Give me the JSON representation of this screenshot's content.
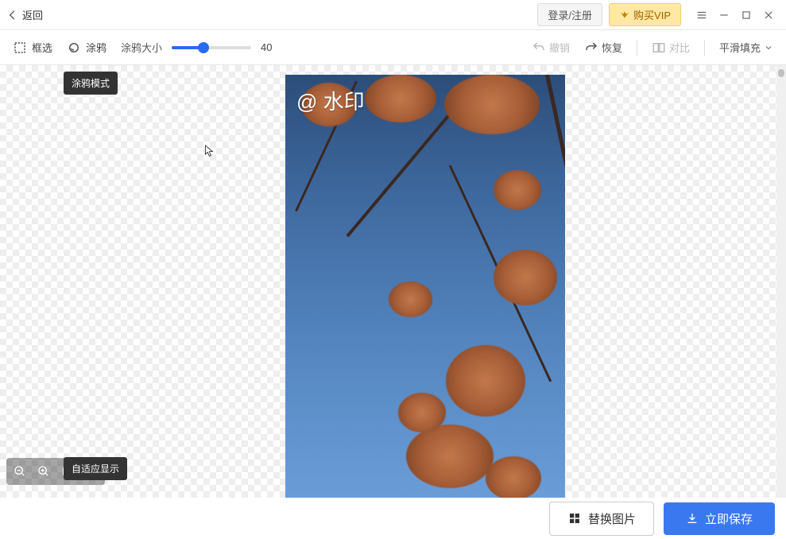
{
  "header": {
    "back": "返回",
    "login": "登录/注册",
    "vip": "购买VIP"
  },
  "toolbar": {
    "marquee": "框选",
    "brush": "涂鸦",
    "brush_size_label": "涂鸦大小",
    "brush_size_value": "40",
    "undo": "撤销",
    "redo": "恢复",
    "compare": "对比",
    "fill_mode": "平滑填充"
  },
  "tooltips": {
    "brush_mode": "涂鸦模式",
    "fit_display": "自适应显示"
  },
  "image": {
    "watermark": "@ 水印"
  },
  "footer": {
    "replace": "替换图片",
    "save": "立即保存"
  }
}
